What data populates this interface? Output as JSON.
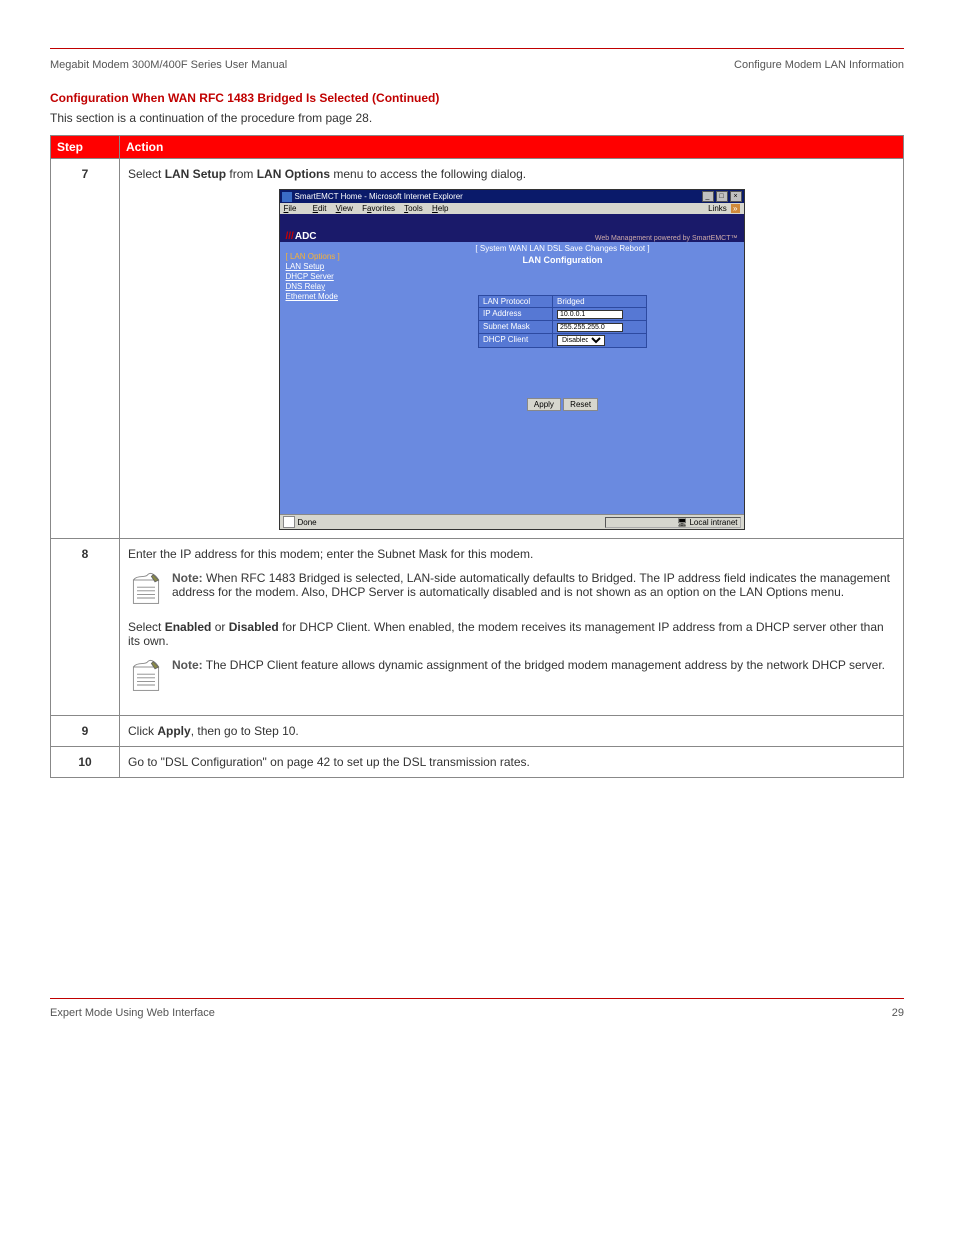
{
  "header": {
    "left": "Megabit Modem 300M/400F Series User Manual",
    "right": "Configure Modem LAN Information"
  },
  "section_title": "Configuration When WAN RFC 1483 Bridged Is Selected (Continued)",
  "intro_text": "This section is a continuation of the procedure from page 28.",
  "table_headers": {
    "step": "Step",
    "action": "Action"
  },
  "step7": {
    "num": "7",
    "line1_before": "Select ",
    "line1_bold1": "LAN Setup",
    "line1_mid": " from ",
    "line1_bold2": "LAN Options",
    "line1_after": " menu to access the following dialog.",
    "screenshot": {
      "window_title": "SmartEMCT Home - Microsoft Internet Explorer",
      "win_buttons": [
        "_",
        "□",
        "×"
      ],
      "menu": {
        "file": "File",
        "edit": "Edit",
        "view": "View",
        "favorites": "Favorites",
        "tools": "Tools",
        "help": "Help"
      },
      "links_label": "Links",
      "go_label": "»",
      "brand": "ADC",
      "poweredby": "Web Management powered by SmartEMCT™",
      "topnav": "[ System  WAN  LAN  DSL  Save Changes  Reboot ]",
      "page_title": "LAN Configuration",
      "sidebar_head": "[ LAN Options ]",
      "sidebar_items": [
        "LAN Setup",
        "DHCP Server",
        "DNS Relay",
        "Ethernet Mode"
      ],
      "form": {
        "lan_protocol_label": "LAN Protocol",
        "lan_protocol_value": "Bridged",
        "ip_label": "IP Address",
        "ip_value": "10.0.0.1",
        "mask_label": "Subnet Mask",
        "mask_value": "255.255.255.0",
        "dhcp_label": "DHCP Client",
        "dhcp_value": "Disabled"
      },
      "apply": "Apply",
      "reset": "Reset",
      "status_done": "Done",
      "status_zone": "Local intranet"
    }
  },
  "step8": {
    "num": "8",
    "line1": "Enter the IP address for this modem; enter the Subnet Mask for this modem.",
    "note1": {
      "bold": "Note:",
      "body": " When RFC 1483 Bridged is selected, LAN-side automatically defaults to Bridged. The IP address field indicates the management address for the modem. Also, DHCP Server is automatically disabled and is not shown as an option on the LAN Options menu."
    },
    "line2_before": "Select ",
    "line2_bold": "Enabled",
    "line2_after": " or ",
    "line2_bold2": "Disabled",
    "line2_tail": " for DHCP Client. When enabled, the modem receives its management IP address from a DHCP server other than its own.",
    "note2": {
      "bold": "Note:",
      "body": " The DHCP Client feature allows dynamic assignment of the bridged modem management address by the network DHCP server."
    }
  },
  "step9": {
    "num": "9",
    "before": "Click ",
    "bold": "Apply",
    "after": ", then go to Step 10."
  },
  "step10": {
    "num": "10",
    "body": "Go to \"DSL Configuration\" on page 42 to set up the DSL transmission rates."
  },
  "footer": {
    "left": "Expert Mode Using Web Interface",
    "right": "29"
  }
}
